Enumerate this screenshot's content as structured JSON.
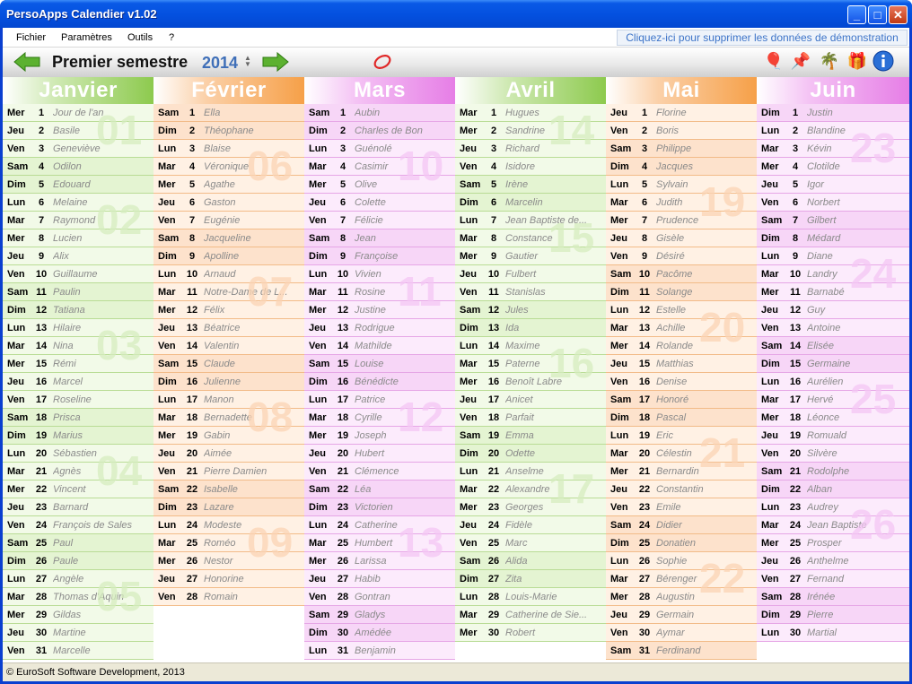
{
  "window": {
    "title": "PersoApps Calendier v1.02",
    "minimize": "_",
    "maximize": "□",
    "close": "✕"
  },
  "menu": {
    "items": [
      "Fichier",
      "Paramètres",
      "Outils",
      "?"
    ],
    "demo_link": "Cliquez-ici pour supprimer les données de démonstration"
  },
  "toolbar": {
    "semester": "Premier semestre",
    "year": "2014",
    "prev_icon": "green-left-arrow-icon",
    "next_icon": "green-right-arrow-icon",
    "icons": [
      "balloons-icon",
      "pushpin-icon",
      "palm-tree-icon",
      "gift-icon",
      "info-icon"
    ]
  },
  "status": {
    "copyright": "© EuroSoft Software Development, 2013"
  },
  "months": [
    {
      "name": "Janvier",
      "weeks": [
        {
          "n": "01",
          "row": 1
        },
        {
          "n": "02",
          "row": 6
        },
        {
          "n": "03",
          "row": 13
        },
        {
          "n": "04",
          "row": 20
        },
        {
          "n": "05",
          "row": 27
        }
      ],
      "days": [
        [
          "Mer",
          "1",
          "Jour de l'an"
        ],
        [
          "Jeu",
          "2",
          "Basile"
        ],
        [
          "Ven",
          "3",
          "Geneviève"
        ],
        [
          "Sam",
          "4",
          "Odilon"
        ],
        [
          "Dim",
          "5",
          "Edouard"
        ],
        [
          "Lun",
          "6",
          "Melaine"
        ],
        [
          "Mar",
          "7",
          "Raymond"
        ],
        [
          "Mer",
          "8",
          "Lucien"
        ],
        [
          "Jeu",
          "9",
          "Alix"
        ],
        [
          "Ven",
          "10",
          "Guillaume"
        ],
        [
          "Sam",
          "11",
          "Paulin"
        ],
        [
          "Dim",
          "12",
          "Tatiana"
        ],
        [
          "Lun",
          "13",
          "Hilaire"
        ],
        [
          "Mar",
          "14",
          "Nina"
        ],
        [
          "Mer",
          "15",
          "Rémi"
        ],
        [
          "Jeu",
          "16",
          "Marcel"
        ],
        [
          "Ven",
          "17",
          "Roseline"
        ],
        [
          "Sam",
          "18",
          "Prisca"
        ],
        [
          "Dim",
          "19",
          "Marius"
        ],
        [
          "Lun",
          "20",
          "Sébastien"
        ],
        [
          "Mar",
          "21",
          "Agnès"
        ],
        [
          "Mer",
          "22",
          "Vincent"
        ],
        [
          "Jeu",
          "23",
          "Barnard"
        ],
        [
          "Ven",
          "24",
          "François de Sales"
        ],
        [
          "Sam",
          "25",
          "Paul"
        ],
        [
          "Dim",
          "26",
          "Paule"
        ],
        [
          "Lun",
          "27",
          "Angèle"
        ],
        [
          "Mar",
          "28",
          "Thomas d'Aquin"
        ],
        [
          "Mer",
          "29",
          "Gildas"
        ],
        [
          "Jeu",
          "30",
          "Martine"
        ],
        [
          "Ven",
          "31",
          "Marcelle"
        ]
      ]
    },
    {
      "name": "Février",
      "weeks": [
        {
          "n": "06",
          "row": 3
        },
        {
          "n": "07",
          "row": 10
        },
        {
          "n": "08",
          "row": 17
        },
        {
          "n": "09",
          "row": 24
        }
      ],
      "days": [
        [
          "Sam",
          "1",
          "Ella"
        ],
        [
          "Dim",
          "2",
          "Théophane"
        ],
        [
          "Lun",
          "3",
          "Blaise"
        ],
        [
          "Mar",
          "4",
          "Véronique"
        ],
        [
          "Mer",
          "5",
          "Agathe"
        ],
        [
          "Jeu",
          "6",
          "Gaston"
        ],
        [
          "Ven",
          "7",
          "Eugénie"
        ],
        [
          "Sam",
          "8",
          "Jacqueline"
        ],
        [
          "Dim",
          "9",
          "Apolline"
        ],
        [
          "Lun",
          "10",
          "Arnaud"
        ],
        [
          "Mar",
          "11",
          "Notre-Dame de L..."
        ],
        [
          "Mer",
          "12",
          "Félix"
        ],
        [
          "Jeu",
          "13",
          "Béatrice"
        ],
        [
          "Ven",
          "14",
          "Valentin"
        ],
        [
          "Sam",
          "15",
          "Claude"
        ],
        [
          "Dim",
          "16",
          "Julienne"
        ],
        [
          "Lun",
          "17",
          "Manon"
        ],
        [
          "Mar",
          "18",
          "Bernadette"
        ],
        [
          "Mer",
          "19",
          "Gabin"
        ],
        [
          "Jeu",
          "20",
          "Aimée"
        ],
        [
          "Ven",
          "21",
          "Pierre Damien"
        ],
        [
          "Sam",
          "22",
          "Isabelle"
        ],
        [
          "Dim",
          "23",
          "Lazare"
        ],
        [
          "Lun",
          "24",
          "Modeste"
        ],
        [
          "Mar",
          "25",
          "Roméo"
        ],
        [
          "Mer",
          "26",
          "Nestor"
        ],
        [
          "Jeu",
          "27",
          "Honorine"
        ],
        [
          "Ven",
          "28",
          "Romain"
        ]
      ]
    },
    {
      "name": "Mars",
      "weeks": [
        {
          "n": "10",
          "row": 3
        },
        {
          "n": "11",
          "row": 10
        },
        {
          "n": "12",
          "row": 17
        },
        {
          "n": "13",
          "row": 24
        }
      ],
      "days": [
        [
          "Sam",
          "1",
          "Aubin"
        ],
        [
          "Dim",
          "2",
          "Charles de Bon"
        ],
        [
          "Lun",
          "3",
          "Guénolé"
        ],
        [
          "Mar",
          "4",
          "Casimir"
        ],
        [
          "Mer",
          "5",
          "Olive"
        ],
        [
          "Jeu",
          "6",
          "Colette"
        ],
        [
          "Ven",
          "7",
          "Félicie"
        ],
        [
          "Sam",
          "8",
          "Jean"
        ],
        [
          "Dim",
          "9",
          "Françoise"
        ],
        [
          "Lun",
          "10",
          "Vivien"
        ],
        [
          "Mar",
          "11",
          "Rosine"
        ],
        [
          "Mer",
          "12",
          "Justine"
        ],
        [
          "Jeu",
          "13",
          "Rodrigue"
        ],
        [
          "Ven",
          "14",
          "Mathilde"
        ],
        [
          "Sam",
          "15",
          "Louise"
        ],
        [
          "Dim",
          "16",
          "Bénédicte"
        ],
        [
          "Lun",
          "17",
          "Patrice"
        ],
        [
          "Mar",
          "18",
          "Cyrille"
        ],
        [
          "Mer",
          "19",
          "Joseph"
        ],
        [
          "Jeu",
          "20",
          "Hubert"
        ],
        [
          "Ven",
          "21",
          "Clémence"
        ],
        [
          "Sam",
          "22",
          "Léa"
        ],
        [
          "Dim",
          "23",
          "Victorien"
        ],
        [
          "Lun",
          "24",
          "Catherine"
        ],
        [
          "Mar",
          "25",
          "Humbert"
        ],
        [
          "Mer",
          "26",
          "Larissa"
        ],
        [
          "Jeu",
          "27",
          "Habib"
        ],
        [
          "Ven",
          "28",
          "Gontran"
        ],
        [
          "Sam",
          "29",
          "Gladys"
        ],
        [
          "Dim",
          "30",
          "Amédée"
        ],
        [
          "Lun",
          "31",
          "Benjamin"
        ]
      ]
    },
    {
      "name": "Avril",
      "weeks": [
        {
          "n": "14",
          "row": 1
        },
        {
          "n": "15",
          "row": 7
        },
        {
          "n": "16",
          "row": 14
        },
        {
          "n": "17",
          "row": 21
        }
      ],
      "days": [
        [
          "Mar",
          "1",
          "Hugues"
        ],
        [
          "Mer",
          "2",
          "Sandrine"
        ],
        [
          "Jeu",
          "3",
          "Richard"
        ],
        [
          "Ven",
          "4",
          "Isidore"
        ],
        [
          "Sam",
          "5",
          "Irène"
        ],
        [
          "Dim",
          "6",
          "Marcelin"
        ],
        [
          "Lun",
          "7",
          "Jean Baptiste de..."
        ],
        [
          "Mar",
          "8",
          "Constance"
        ],
        [
          "Mer",
          "9",
          "Gautier"
        ],
        [
          "Jeu",
          "10",
          "Fulbert"
        ],
        [
          "Ven",
          "11",
          "Stanislas"
        ],
        [
          "Sam",
          "12",
          "Jules"
        ],
        [
          "Dim",
          "13",
          "Ida"
        ],
        [
          "Lun",
          "14",
          "Maxime"
        ],
        [
          "Mar",
          "15",
          "Paterne"
        ],
        [
          "Mer",
          "16",
          "Benoît Labre"
        ],
        [
          "Jeu",
          "17",
          "Anicet"
        ],
        [
          "Ven",
          "18",
          "Parfait"
        ],
        [
          "Sam",
          "19",
          "Emma"
        ],
        [
          "Dim",
          "20",
          "Odette"
        ],
        [
          "Lun",
          "21",
          "Anselme"
        ],
        [
          "Mar",
          "22",
          "Alexandre"
        ],
        [
          "Mer",
          "23",
          "Georges"
        ],
        [
          "Jeu",
          "24",
          "Fidèle"
        ],
        [
          "Ven",
          "25",
          "Marc"
        ],
        [
          "Sam",
          "26",
          "Alida"
        ],
        [
          "Dim",
          "27",
          "Zita"
        ],
        [
          "Lun",
          "28",
          "Louis-Marie"
        ],
        [
          "Mar",
          "29",
          "Catherine de Sie..."
        ],
        [
          "Mer",
          "30",
          "Robert"
        ]
      ]
    },
    {
      "name": "Mai",
      "weeks": [
        {
          "n": "19",
          "row": 5
        },
        {
          "n": "20",
          "row": 12
        },
        {
          "n": "21",
          "row": 19
        },
        {
          "n": "22",
          "row": 26
        }
      ],
      "days": [
        [
          "Jeu",
          "1",
          "Florine"
        ],
        [
          "Ven",
          "2",
          "Boris"
        ],
        [
          "Sam",
          "3",
          "Philippe"
        ],
        [
          "Dim",
          "4",
          "Jacques"
        ],
        [
          "Lun",
          "5",
          "Sylvain"
        ],
        [
          "Mar",
          "6",
          "Judith"
        ],
        [
          "Mer",
          "7",
          "Prudence"
        ],
        [
          "Jeu",
          "8",
          "Gisèle"
        ],
        [
          "Ven",
          "9",
          "Désiré"
        ],
        [
          "Sam",
          "10",
          "Pacôme"
        ],
        [
          "Dim",
          "11",
          "Solange"
        ],
        [
          "Lun",
          "12",
          "Estelle"
        ],
        [
          "Mar",
          "13",
          "Achille"
        ],
        [
          "Mer",
          "14",
          "Rolande"
        ],
        [
          "Jeu",
          "15",
          "Matthias"
        ],
        [
          "Ven",
          "16",
          "Denise"
        ],
        [
          "Sam",
          "17",
          "Honoré"
        ],
        [
          "Dim",
          "18",
          "Pascal"
        ],
        [
          "Lun",
          "19",
          "Eric"
        ],
        [
          "Mar",
          "20",
          "Célestin"
        ],
        [
          "Mer",
          "21",
          "Bernardin"
        ],
        [
          "Jeu",
          "22",
          "Constantin"
        ],
        [
          "Ven",
          "23",
          "Emile"
        ],
        [
          "Sam",
          "24",
          "Didier"
        ],
        [
          "Dim",
          "25",
          "Donatien"
        ],
        [
          "Lun",
          "26",
          "Sophie"
        ],
        [
          "Mar",
          "27",
          "Bérenger"
        ],
        [
          "Mer",
          "28",
          "Augustin"
        ],
        [
          "Jeu",
          "29",
          "Germain"
        ],
        [
          "Ven",
          "30",
          "Aymar"
        ],
        [
          "Sam",
          "31",
          "Ferdinand"
        ]
      ]
    },
    {
      "name": "Juin",
      "weeks": [
        {
          "n": "23",
          "row": 2
        },
        {
          "n": "24",
          "row": 9
        },
        {
          "n": "25",
          "row": 16
        },
        {
          "n": "26",
          "row": 23
        }
      ],
      "days": [
        [
          "Dim",
          "1",
          "Justin"
        ],
        [
          "Lun",
          "2",
          "Blandine"
        ],
        [
          "Mar",
          "3",
          "Kévin"
        ],
        [
          "Mer",
          "4",
          "Clotilde"
        ],
        [
          "Jeu",
          "5",
          "Igor"
        ],
        [
          "Ven",
          "6",
          "Norbert"
        ],
        [
          "Sam",
          "7",
          "Gilbert"
        ],
        [
          "Dim",
          "8",
          "Médard"
        ],
        [
          "Lun",
          "9",
          "Diane"
        ],
        [
          "Mar",
          "10",
          "Landry"
        ],
        [
          "Mer",
          "11",
          "Barnabé"
        ],
        [
          "Jeu",
          "12",
          "Guy"
        ],
        [
          "Ven",
          "13",
          "Antoine"
        ],
        [
          "Sam",
          "14",
          "Elisée"
        ],
        [
          "Dim",
          "15",
          "Germaine"
        ],
        [
          "Lun",
          "16",
          "Aurélien"
        ],
        [
          "Mar",
          "17",
          "Hervé"
        ],
        [
          "Mer",
          "18",
          "Léonce"
        ],
        [
          "Jeu",
          "19",
          "Romuald"
        ],
        [
          "Ven",
          "20",
          "Silvère"
        ],
        [
          "Sam",
          "21",
          "Rodolphe"
        ],
        [
          "Dim",
          "22",
          "Alban"
        ],
        [
          "Lun",
          "23",
          "Audrey"
        ],
        [
          "Mar",
          "24",
          "Jean Baptiste"
        ],
        [
          "Mer",
          "25",
          "Prosper"
        ],
        [
          "Jeu",
          "26",
          "Anthelme"
        ],
        [
          "Ven",
          "27",
          "Fernand"
        ],
        [
          "Sam",
          "28",
          "Irénée"
        ],
        [
          "Dim",
          "29",
          "Pierre"
        ],
        [
          "Lun",
          "30",
          "Martial"
        ]
      ]
    }
  ],
  "colors": {
    "green": {
      "head": "#8dca4e",
      "light": "#f2fae8",
      "dark": "#e4f4d2",
      "week": "#d6edbf",
      "line": "#b9dc95"
    },
    "orange": {
      "head": "#f6a048",
      "light": "#fff1e4",
      "dark": "#fde2cc",
      "week": "#fbd4b4",
      "line": "#f2bb88"
    },
    "pink": {
      "head": "#e67ee6",
      "light": "#fcebfc",
      "dark": "#f7d6f7",
      "week": "#f4c6f4",
      "line": "#e6a6e6"
    }
  }
}
